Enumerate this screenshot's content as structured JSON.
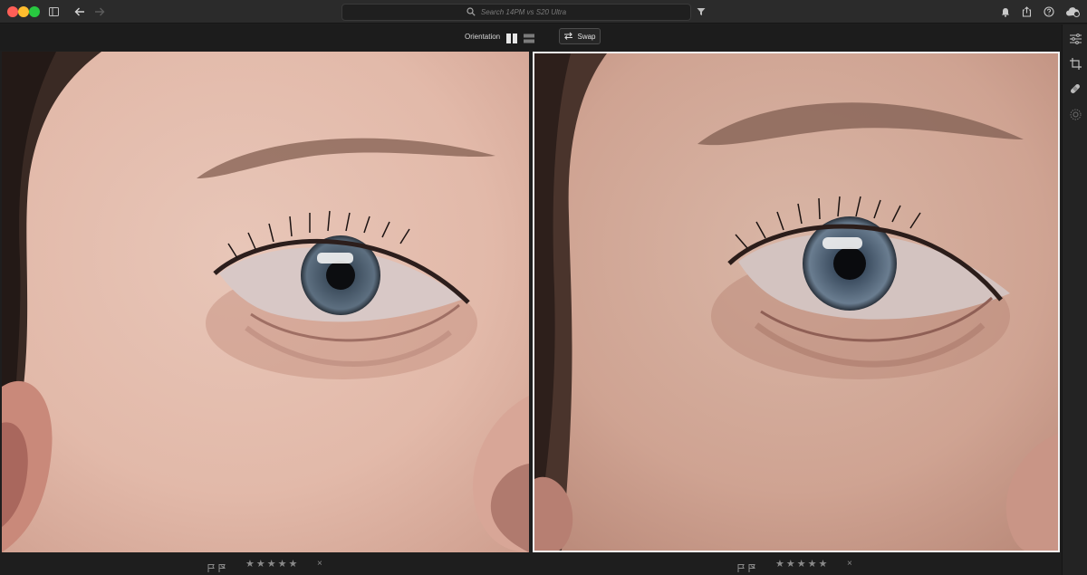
{
  "window": {
    "search_placeholder": "Search 14PM vs S20 Ultra"
  },
  "compare_toolbar": {
    "orientation_label": "Orientation",
    "swap_label": "Swap"
  },
  "photos": [
    {
      "rating_stars": "★★★★★",
      "reject": "×"
    },
    {
      "rating_stars": "★★★★★",
      "reject": "×"
    }
  ],
  "icons": {
    "titlebar": [
      "sidebar-toggle-icon",
      "back-arrow-icon",
      "forward-arrow-icon",
      "search-icon",
      "filter-icon",
      "bell-icon",
      "share-icon",
      "help-icon",
      "cloud-sync-icon"
    ],
    "right_panel": [
      "edit-sliders-icon",
      "crop-icon",
      "healing-bandage-icon",
      "masking-icon"
    ]
  },
  "colors": {
    "window_bg": "#1e1e1e",
    "selected_border": "#f1f1f1"
  }
}
